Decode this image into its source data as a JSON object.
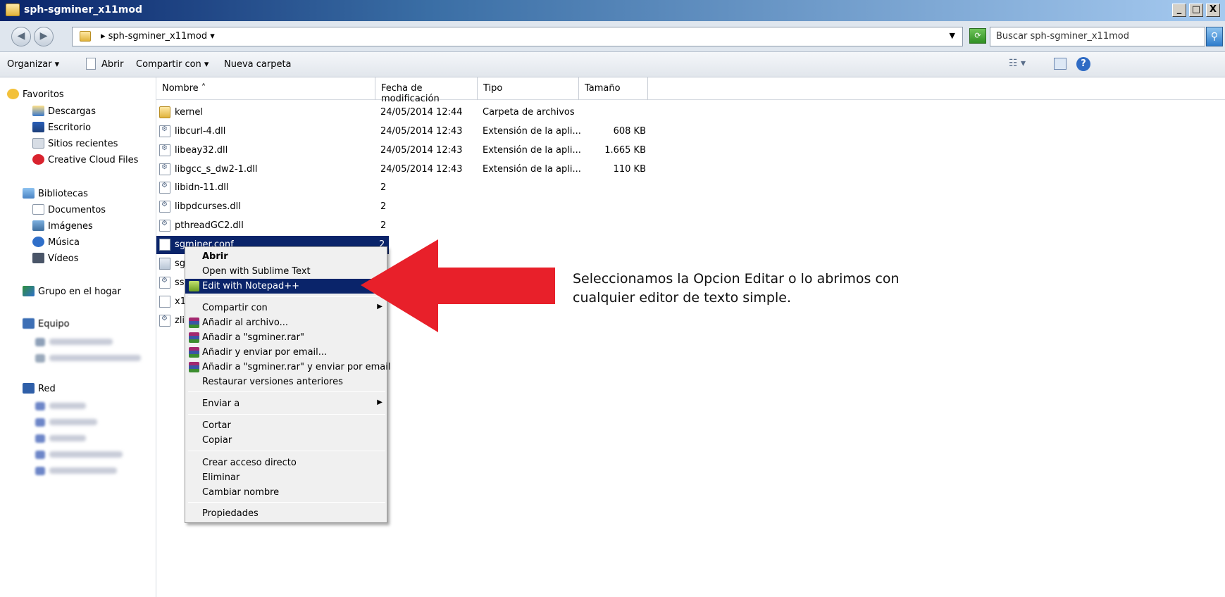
{
  "window": {
    "title": "sph-sgminer_x11mod",
    "controls": [
      "_",
      "□",
      "X"
    ]
  },
  "address": {
    "path": "▸ sph-sgminer_x11mod ▾",
    "search_placeholder": "Buscar sph-sgminer_x11mod"
  },
  "toolbar": {
    "organize": "Organizar ▾",
    "open": "Abrir",
    "share": "Compartir con ▾",
    "new_folder": "Nueva carpeta"
  },
  "nav": {
    "favorites": "Favoritos",
    "downloads": "Descargas",
    "desktop": "Escritorio",
    "recent": "Sitios recientes",
    "creative_cloud": "Creative Cloud Files",
    "libraries": "Bibliotecas",
    "documents": "Documentos",
    "images": "Imágenes",
    "music": "Música",
    "videos": "Vídeos",
    "homegroup": "Grupo en el hogar",
    "computer": "Equipo",
    "network": "Red"
  },
  "columns": {
    "name": "Nombre ˄",
    "date": "Fecha de modificación",
    "type": "Tipo",
    "size": "Tamaño"
  },
  "files": [
    {
      "name": "kernel",
      "date": "24/05/2014 12:44",
      "type": "Carpeta de archivos",
      "size": "",
      "icon": "folder-icon"
    },
    {
      "name": "libcurl-4.dll",
      "date": "24/05/2014 12:43",
      "type": "Extensión de la apli...",
      "size": "608 KB",
      "icon": "dll-icon"
    },
    {
      "name": "libeay32.dll",
      "date": "24/05/2014 12:43",
      "type": "Extensión de la apli...",
      "size": "1.665 KB",
      "icon": "dll-icon"
    },
    {
      "name": "libgcc_s_dw2-1.dll",
      "date": "24/05/2014 12:43",
      "type": "Extensión de la apli...",
      "size": "110 KB",
      "icon": "dll-icon"
    },
    {
      "name": "libidn-11.dll",
      "date": "2",
      "type": "",
      "size": "",
      "icon": "dll-icon"
    },
    {
      "name": "libpdcurses.dll",
      "date": "2",
      "type": "",
      "size": "",
      "icon": "dll-icon"
    },
    {
      "name": "pthreadGC2.dll",
      "date": "2",
      "type": "",
      "size": "",
      "icon": "dll-icon"
    },
    {
      "name": "sgminer.conf",
      "date": "2",
      "type": "",
      "size": "",
      "icon": "text-file-icon"
    },
    {
      "name": "sgr",
      "date": "",
      "type": "",
      "size": "",
      "icon": "exe-icon"
    },
    {
      "name": "ssl",
      "date": "",
      "type": "",
      "size": "",
      "icon": "dll-icon"
    },
    {
      "name": "x1",
      "date": "",
      "type": "",
      "size": "",
      "icon": "text-file-icon"
    },
    {
      "name": "zlib",
      "date": "",
      "type": "",
      "size": "",
      "icon": "dll-icon"
    }
  ],
  "context_menu": {
    "open": "Abrir",
    "sublime": "Open with Sublime Text",
    "notepad": "Edit with Notepad++",
    "share": "Compartir con",
    "add_archive": "Añadir al archivo...",
    "add_rar": "Añadir a \"sgminer.rar\"",
    "add_email": "Añadir y enviar por email...",
    "add_rar_email": "Añadir a \"sgminer.rar\" y enviar por email",
    "restore": "Restaurar versiones anteriores",
    "send_to": "Enviar a",
    "cut": "Cortar",
    "copy": "Copiar",
    "shortcut": "Crear acceso directo",
    "delete": "Eliminar",
    "rename": "Cambiar nombre",
    "properties": "Propiedades"
  },
  "annotation": {
    "line1": "Seleccionamos la Opcion Editar o lo abrimos con",
    "line2": "cualquier editor de texto simple."
  },
  "colors": {
    "selection": "#0a246a",
    "arrow": "#e8202a"
  }
}
